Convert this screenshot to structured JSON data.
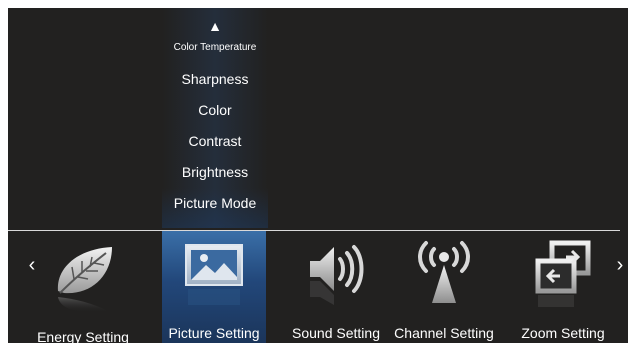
{
  "submenu": {
    "up_arrow": "▲",
    "items": [
      {
        "label": "Color Temperature",
        "size": "small"
      },
      {
        "label": "Sharpness"
      },
      {
        "label": "Color"
      },
      {
        "label": "Contrast"
      },
      {
        "label": "Brightness"
      },
      {
        "label": "Picture Mode"
      }
    ]
  },
  "nav": {
    "left_arrow": "‹",
    "right_arrow": "›"
  },
  "menu": {
    "selected": "Picture Setting",
    "items": [
      {
        "label": "Energy Setting",
        "icon": "leaf-icon"
      },
      {
        "label": "Picture Setting",
        "icon": "picture-icon"
      },
      {
        "label": "Sound Setting",
        "icon": "speaker-icon"
      },
      {
        "label": "Channel Setting",
        "icon": "antenna-icon"
      },
      {
        "label": "Zoom Setting",
        "icon": "zoom-icon"
      }
    ]
  },
  "colors": {
    "background": "#222120",
    "highlight": "#2f5f96",
    "text": "#ffffff",
    "icon": "#bfbfbf"
  }
}
